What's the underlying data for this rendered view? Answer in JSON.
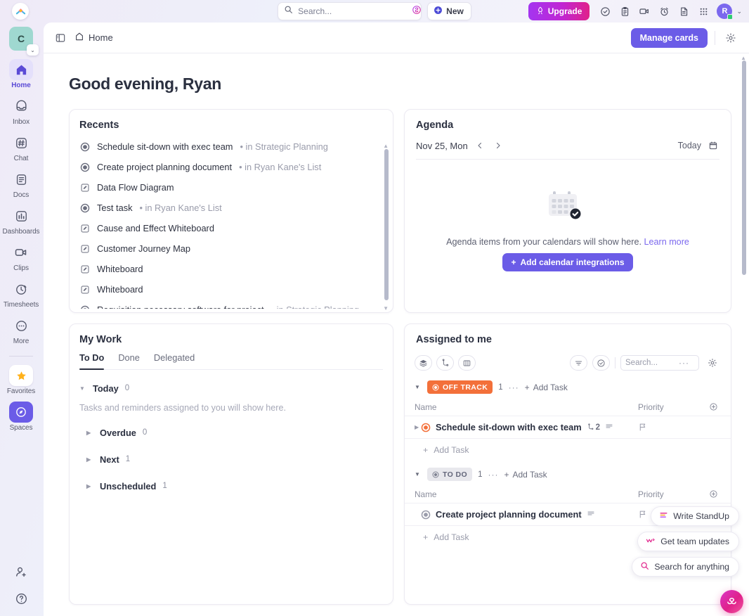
{
  "topbar": {
    "logo_icon": "clickup-logo-icon",
    "search": {
      "placeholder": "Search...",
      "value": "",
      "icon": "search-icon",
      "ai_icon": "ai-sparkle-icon"
    },
    "new_button": {
      "label": "New",
      "icon": "plus-circle-icon"
    },
    "upgrade_button": {
      "label": "Upgrade",
      "icon": "rocket-icon"
    },
    "icons": [
      {
        "name": "check-circle-icon",
        "glyph": "check"
      },
      {
        "name": "clipboard-icon",
        "glyph": "clipboard"
      },
      {
        "name": "video-camera-icon",
        "glyph": "video"
      },
      {
        "name": "alarm-clock-icon",
        "glyph": "alarm"
      },
      {
        "name": "document-icon",
        "glyph": "doc"
      },
      {
        "name": "apps-grid-icon",
        "glyph": "grid"
      }
    ],
    "avatar": {
      "initial": "R",
      "status": "online"
    },
    "avatar_chevron": "⌄"
  },
  "sidebar": {
    "workspace": {
      "initial": "C",
      "color": "#9fd8d0",
      "chevron": "⌄"
    },
    "items": [
      {
        "label": "Home",
        "icon": "home-icon",
        "active": true
      },
      {
        "label": "Inbox",
        "icon": "inbox-icon",
        "active": false
      },
      {
        "label": "Chat",
        "icon": "chat-hash-icon",
        "active": false
      },
      {
        "label": "Docs",
        "icon": "docs-icon",
        "active": false
      },
      {
        "label": "Dashboards",
        "icon": "dashboards-bar-icon",
        "active": false
      },
      {
        "label": "Clips",
        "icon": "clips-video-icon",
        "active": false
      },
      {
        "label": "Timesheets",
        "icon": "timesheets-clock-icon",
        "active": false
      },
      {
        "label": "More",
        "icon": "more-dots-icon",
        "active": false
      }
    ],
    "pinned": [
      {
        "label": "Favorites",
        "icon": "star-icon"
      },
      {
        "label": "Spaces",
        "icon": "spaces-compass-icon"
      }
    ],
    "bottom": [
      {
        "name": "invite-people-icon"
      },
      {
        "name": "help-question-icon"
      }
    ]
  },
  "header": {
    "panel_toggle_icon": "sidebar-toggle-icon",
    "breadcrumb": {
      "icon": "home-icon",
      "label": "Home"
    },
    "manage_cards_label": "Manage cards",
    "settings_icon": "gear-icon"
  },
  "greeting": "Good evening, Ryan",
  "recents": {
    "title": "Recents",
    "items": [
      {
        "name": "Schedule sit-down with exec team",
        "location": " • in Strategic Planning",
        "icon": "task-circle-icon"
      },
      {
        "name": "Create project planning document",
        "location": " • in Ryan Kane's List",
        "icon": "task-circle-icon"
      },
      {
        "name": "Data Flow Diagram",
        "location": "",
        "icon": "whiteboard-icon"
      },
      {
        "name": "Test task",
        "location": " • in Ryan Kane's List",
        "icon": "task-circle-icon"
      },
      {
        "name": "Cause and Effect Whiteboard",
        "location": "",
        "icon": "whiteboard-icon"
      },
      {
        "name": "Customer Journey Map",
        "location": "",
        "icon": "whiteboard-icon"
      },
      {
        "name": "Whiteboard",
        "location": "",
        "icon": "whiteboard-icon"
      },
      {
        "name": "Whiteboard",
        "location": "",
        "icon": "whiteboard-icon"
      },
      {
        "name": "Requisition necessary software for project",
        "location": " • in Strategic Planning",
        "icon": "task-circle-icon"
      }
    ]
  },
  "my_work": {
    "title": "My Work",
    "tabs": [
      {
        "label": "To Do",
        "active": true
      },
      {
        "label": "Done",
        "active": false
      },
      {
        "label": "Delegated",
        "active": false
      }
    ],
    "groups": [
      {
        "label": "Today",
        "count": "0",
        "expanded": true
      },
      {
        "label": "Overdue",
        "count": "0",
        "expanded": false
      },
      {
        "label": "Next",
        "count": "1",
        "expanded": false
      },
      {
        "label": "Unscheduled",
        "count": "1",
        "expanded": false
      }
    ],
    "empty_note": "Tasks and reminders assigned to you will show here."
  },
  "agenda": {
    "title": "Agenda",
    "date": "Nov 25, Mon",
    "prev_icon": "chevron-left-icon",
    "next_icon": "chevron-right-icon",
    "today_label": "Today",
    "calendar_icon": "calendar-icon",
    "empty_text": "Agenda items from your calendars will show here.",
    "learn_more": "Learn more",
    "add_button": "Add calendar integrations"
  },
  "assigned": {
    "title": "Assigned to me",
    "toolbar": {
      "left_icons": [
        {
          "name": "layers-group-icon"
        },
        {
          "name": "subtasks-icon"
        },
        {
          "name": "columns-icon"
        }
      ],
      "filter_icon": "filter-icon",
      "me_mode_icon": "check-circle-icon",
      "search_placeholder": "Search...",
      "search_value": "",
      "more_icon": "more-dots-icon",
      "settings_icon": "gear-icon"
    },
    "columns": {
      "name": "Name",
      "priority": "Priority"
    },
    "add_task_label": "Add Task",
    "groups": [
      {
        "status": "OFF TRACK",
        "status_color": "#f3703a",
        "count": "1",
        "tasks": [
          {
            "name": "Schedule sit-down with exec team",
            "subtask_count": "2",
            "has_description": true,
            "status_color": "#f3703a",
            "has_caret": true
          }
        ]
      },
      {
        "status": "TO DO",
        "status_color": "#e8e8ed",
        "count": "1",
        "tasks": [
          {
            "name": "Create project planning document",
            "subtask_count": "",
            "has_description": true,
            "status_color": "#9a9cab",
            "has_caret": false
          }
        ]
      }
    ]
  },
  "ai_actions": [
    {
      "label": "Write StandUp",
      "icon": "standup-lines-icon"
    },
    {
      "label": "Get team updates",
      "icon": "team-updates-icon"
    },
    {
      "label": "Search for anything",
      "icon": "search-icon"
    }
  ],
  "ai_fab": {
    "name": "ai-brain-icon"
  },
  "colors": {
    "accent": "#6b5ce7",
    "upgrade_start": "#a435f0",
    "upgrade_end": "#e0218a",
    "off_track": "#f3703a",
    "todo_grey": "#e8e8ed",
    "workspace": "#9fd8d0",
    "link": "#7b68ee"
  }
}
